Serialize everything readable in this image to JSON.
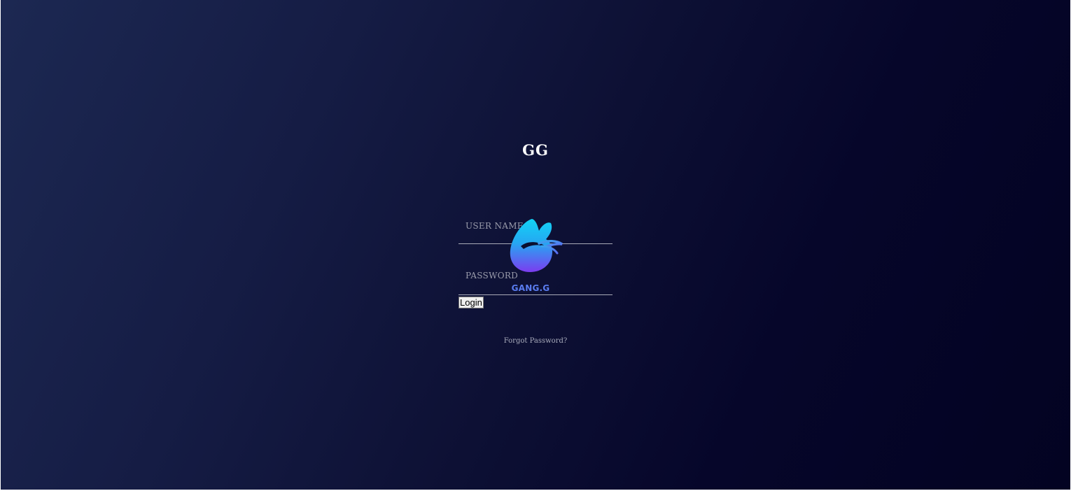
{
  "app": {
    "title": "GG"
  },
  "login_form": {
    "username_label": "USER NAME",
    "password_label": "PASSWORD",
    "login_button": "Login",
    "forgot_password_link": "Forgot Password?"
  },
  "logo": {
    "text": "GANG.G",
    "icon": "butterfly-g-logo-icon"
  },
  "colors": {
    "background_start": "#1c2852",
    "background_end": "#030322",
    "logo_cyan": "#12d3f5",
    "logo_purple": "#7c3cf0",
    "logo_text": "#5a7cf0"
  }
}
